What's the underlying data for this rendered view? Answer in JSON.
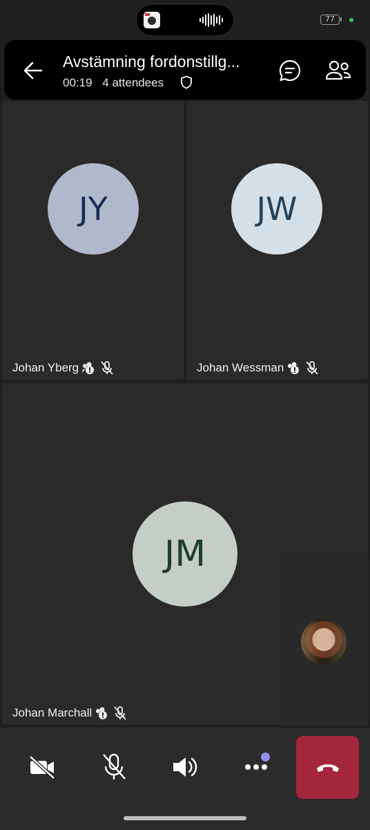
{
  "status_bar": {
    "battery": "77",
    "island_thumb_icon": "app-thumbnail",
    "island_audio_icon": "audio-wave-icon"
  },
  "header": {
    "title": "Avstämning fordonstillg...",
    "duration": "00:19",
    "attendees": "4 attendees",
    "icons": [
      "back-arrow-icon",
      "shield-icon",
      "chat-icon",
      "participants-icon"
    ]
  },
  "participants": [
    {
      "initials": "JY",
      "name": "Johan Yberg",
      "avatar_bg": "#b0b9cb",
      "initials_color": "#1a2b55"
    },
    {
      "initials": "JW",
      "name": "Johan Wessman",
      "avatar_bg": "#d5dfe7",
      "initials_color": "#23425a"
    },
    {
      "initials": "JM",
      "name": "Johan Marchall",
      "avatar_bg": "#c4cec6",
      "initials_color": "#1f3d2a"
    }
  ],
  "controls": {
    "camera": "camera-off-icon",
    "mic": "mic-off-icon",
    "speaker": "speaker-icon",
    "more": "more-icon",
    "end": "end-call-icon"
  },
  "colors": {
    "end_call": "#a4263c",
    "notification_badge": "#8f90f0",
    "tile_bg": "#2a2a2a"
  }
}
